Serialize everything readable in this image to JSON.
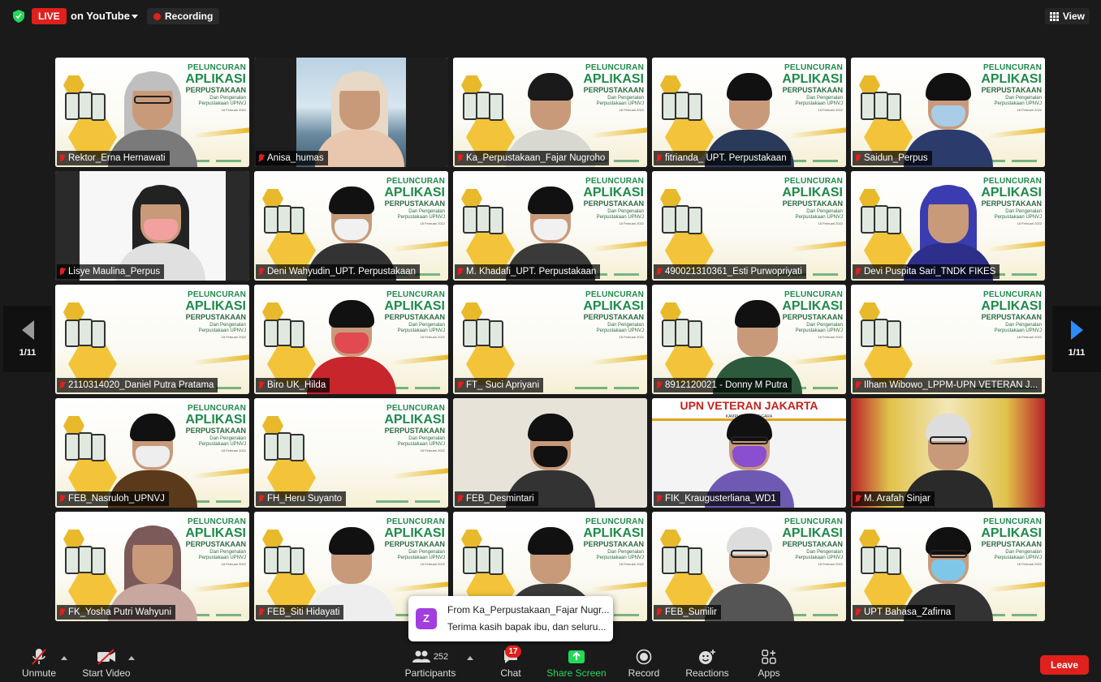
{
  "topbar": {
    "live_label": "LIVE",
    "stream_label": "on YouTube",
    "recording_label": "Recording",
    "view_label": "View"
  },
  "pager": {
    "left_label": "1/11",
    "right_label": "1/11"
  },
  "colors": {
    "live_red": "#e0201c",
    "active_speaker": "#23d959",
    "share_green": "#23d959",
    "pager_blue": "#2d8cff"
  },
  "slide": {
    "line1": "PELUNCURAN",
    "line2": "APLIKASI",
    "line3": "PERPUSTAKAAN",
    "line4": "Dan Pengenalan",
    "line5": "Perpustakaan UPNVJ",
    "line6": "18 Februari 2022"
  },
  "upn_banner": {
    "title": "UPN VETERAN JAKARTA",
    "subtitle": "KAMPUS BELA NEGARA"
  },
  "participants": [
    {
      "name": "Rektor_Erna Hernawati"
    },
    {
      "name": "Anisa_humas"
    },
    {
      "name": "Ka_Perpustakaan_Fajar Nugroho"
    },
    {
      "name": "fitrianda_ UPT. Perpustakaan"
    },
    {
      "name": "Saidun_Perpus"
    },
    {
      "name": "Lisye Maulina_Perpus"
    },
    {
      "name": "Deni Wahyudin_UPT. Perpustakaan"
    },
    {
      "name": "M. Khadafi_UPT. Perpustakaan"
    },
    {
      "name": "490021310361_Esti Purwopriyati"
    },
    {
      "name": "Devi Puspita Sari_TNDK FIKES"
    },
    {
      "name": "2110314020_Daniel Putra Pratama"
    },
    {
      "name": "Biro UK_Hilda"
    },
    {
      "name": "FT_ Suci Apriyani"
    },
    {
      "name": "8912120021 - Donny M Putra"
    },
    {
      "name": "Ilham Wibowo_LPPM-UPN VETERAN J..."
    },
    {
      "name": "FEB_Nasruloh_UPNVJ"
    },
    {
      "name": "FH_Heru Suyanto"
    },
    {
      "name": "FEB_Desmintari"
    },
    {
      "name": "FIK_Kraugusterliana_WD1"
    },
    {
      "name": "M. Arafah Sinjar"
    },
    {
      "name": "FK_Yosha Putri Wahyuni"
    },
    {
      "name": "FEB_Siti Hidayati"
    },
    {
      "name": ""
    },
    {
      "name": "FEB_Sumilir"
    },
    {
      "name": "UPT Bahasa_Zafirna"
    }
  ],
  "chat_toast": {
    "avatar_letter": "Z",
    "from_line": "From Ka_Perpustakaan_Fajar Nugr...",
    "message_line": "Terima kasih bapak ibu, dan seluru..."
  },
  "toolbar": {
    "unmute": "Unmute",
    "start_video": "Start Video",
    "participants_count": "252",
    "participants": "Participants",
    "chat_badge": "17",
    "chat": "Chat",
    "share_screen": "Share Screen",
    "record": "Record",
    "reactions": "Reactions",
    "apps": "Apps",
    "leave": "Leave"
  }
}
